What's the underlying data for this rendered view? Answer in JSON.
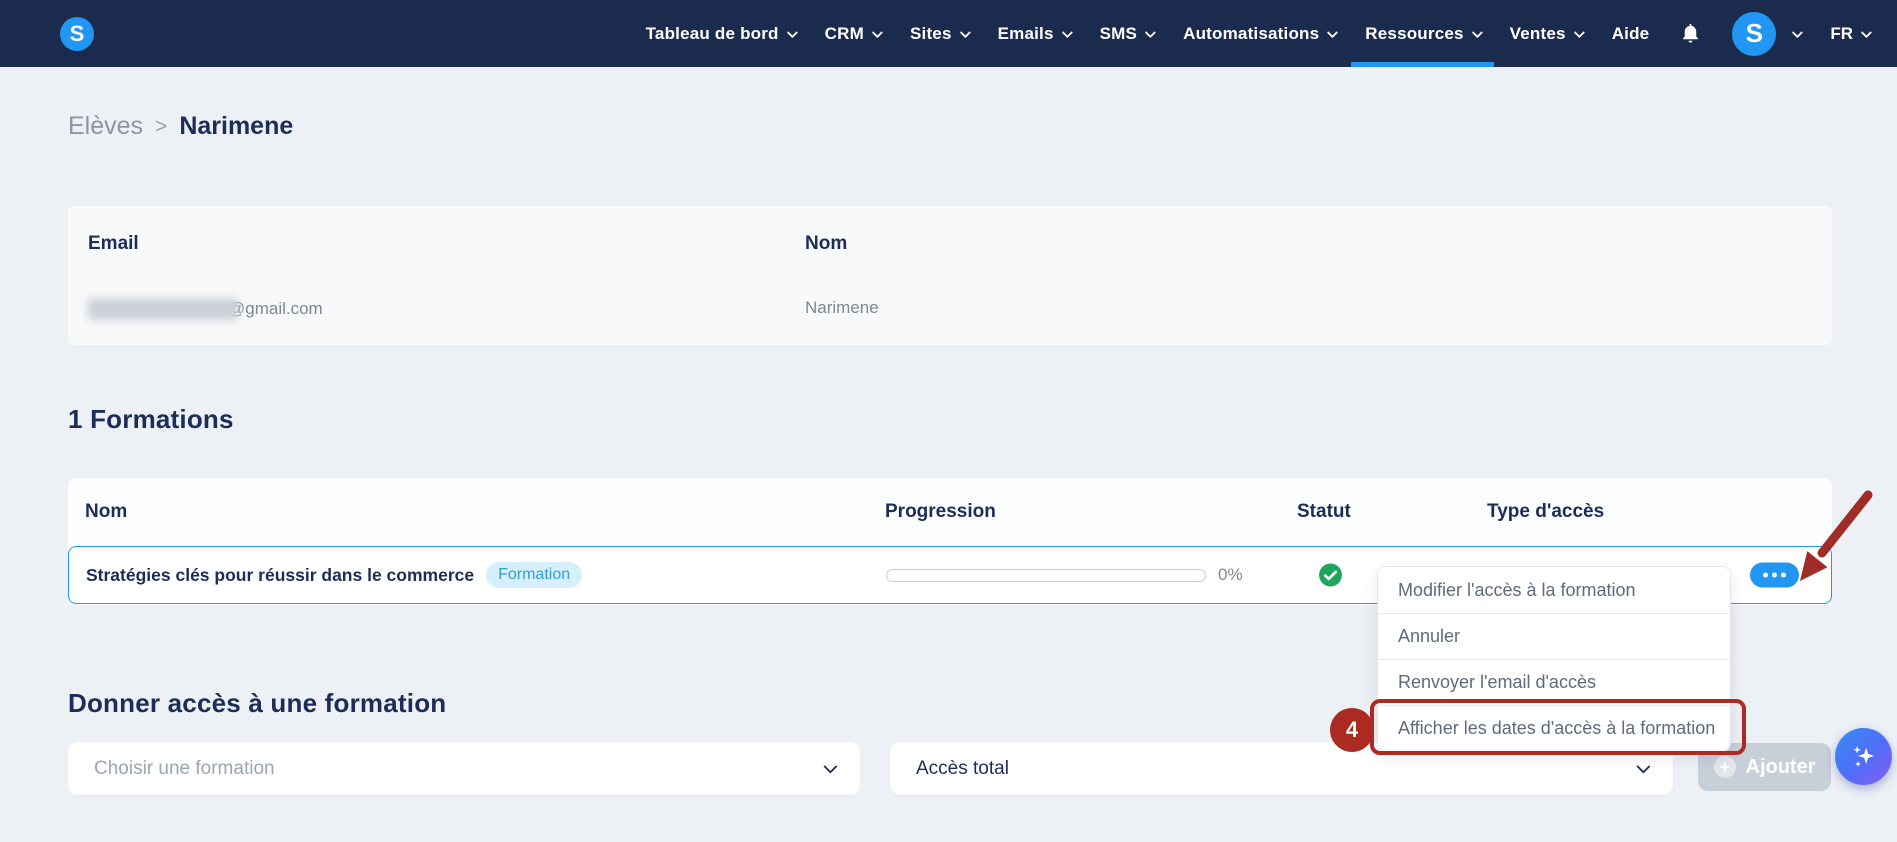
{
  "navbar": {
    "logo_letter": "S",
    "items": [
      {
        "label": "Tableau de bord"
      },
      {
        "label": "CRM"
      },
      {
        "label": "Sites"
      },
      {
        "label": "Emails"
      },
      {
        "label": "SMS"
      },
      {
        "label": "Automatisations"
      },
      {
        "label": "Ressources",
        "active": true
      },
      {
        "label": "Ventes"
      }
    ],
    "help_label": "Aide",
    "bell_icon": "notification-bell",
    "avatar_letter": "S",
    "locale": "FR"
  },
  "breadcrumb": {
    "parent": "Elèves",
    "separator": ">",
    "current": "Narimene"
  },
  "student_card": {
    "email_label": "Email",
    "email_value_visible": "@gmail.com",
    "name_label": "Nom",
    "name_value": "Narimene"
  },
  "formations_section": {
    "title": "1 Formations",
    "table": {
      "headers": {
        "name": "Nom",
        "progression": "Progression",
        "status": "Statut",
        "access_type": "Type d'accès"
      },
      "row": {
        "name": "Stratégies clés pour réussir dans le commerce",
        "badge": "Formation",
        "progress_percent": 0,
        "progress_label": "0%",
        "status_icon": "green-check",
        "actions_icon": "ellipsis"
      }
    }
  },
  "context_menu": {
    "items": [
      "Modifier l'accès à la formation",
      "Annuler",
      "Renvoyer l'email d'accès",
      "Afficher les dates d'accès à la formation"
    ],
    "highlighted_index": 3,
    "step_badge": "4"
  },
  "give_access_section": {
    "title": "Donner accès à une formation",
    "formation_select_placeholder": "Choisir une formation",
    "access_select_value": "Accès total",
    "add_button_label": "Ajouter"
  },
  "colors": {
    "navbar_bg": "#1b2b4d",
    "brand_blue": "#2196f3",
    "heading_navy": "#1b2d58",
    "page_bg": "#edf0f5",
    "annotation_red": "#ab2b23",
    "success_green": "#1fa55e",
    "badge_bg": "#d7eefb",
    "badge_text": "#2e9fd9",
    "disabled_button": "#c7cfd9"
  }
}
